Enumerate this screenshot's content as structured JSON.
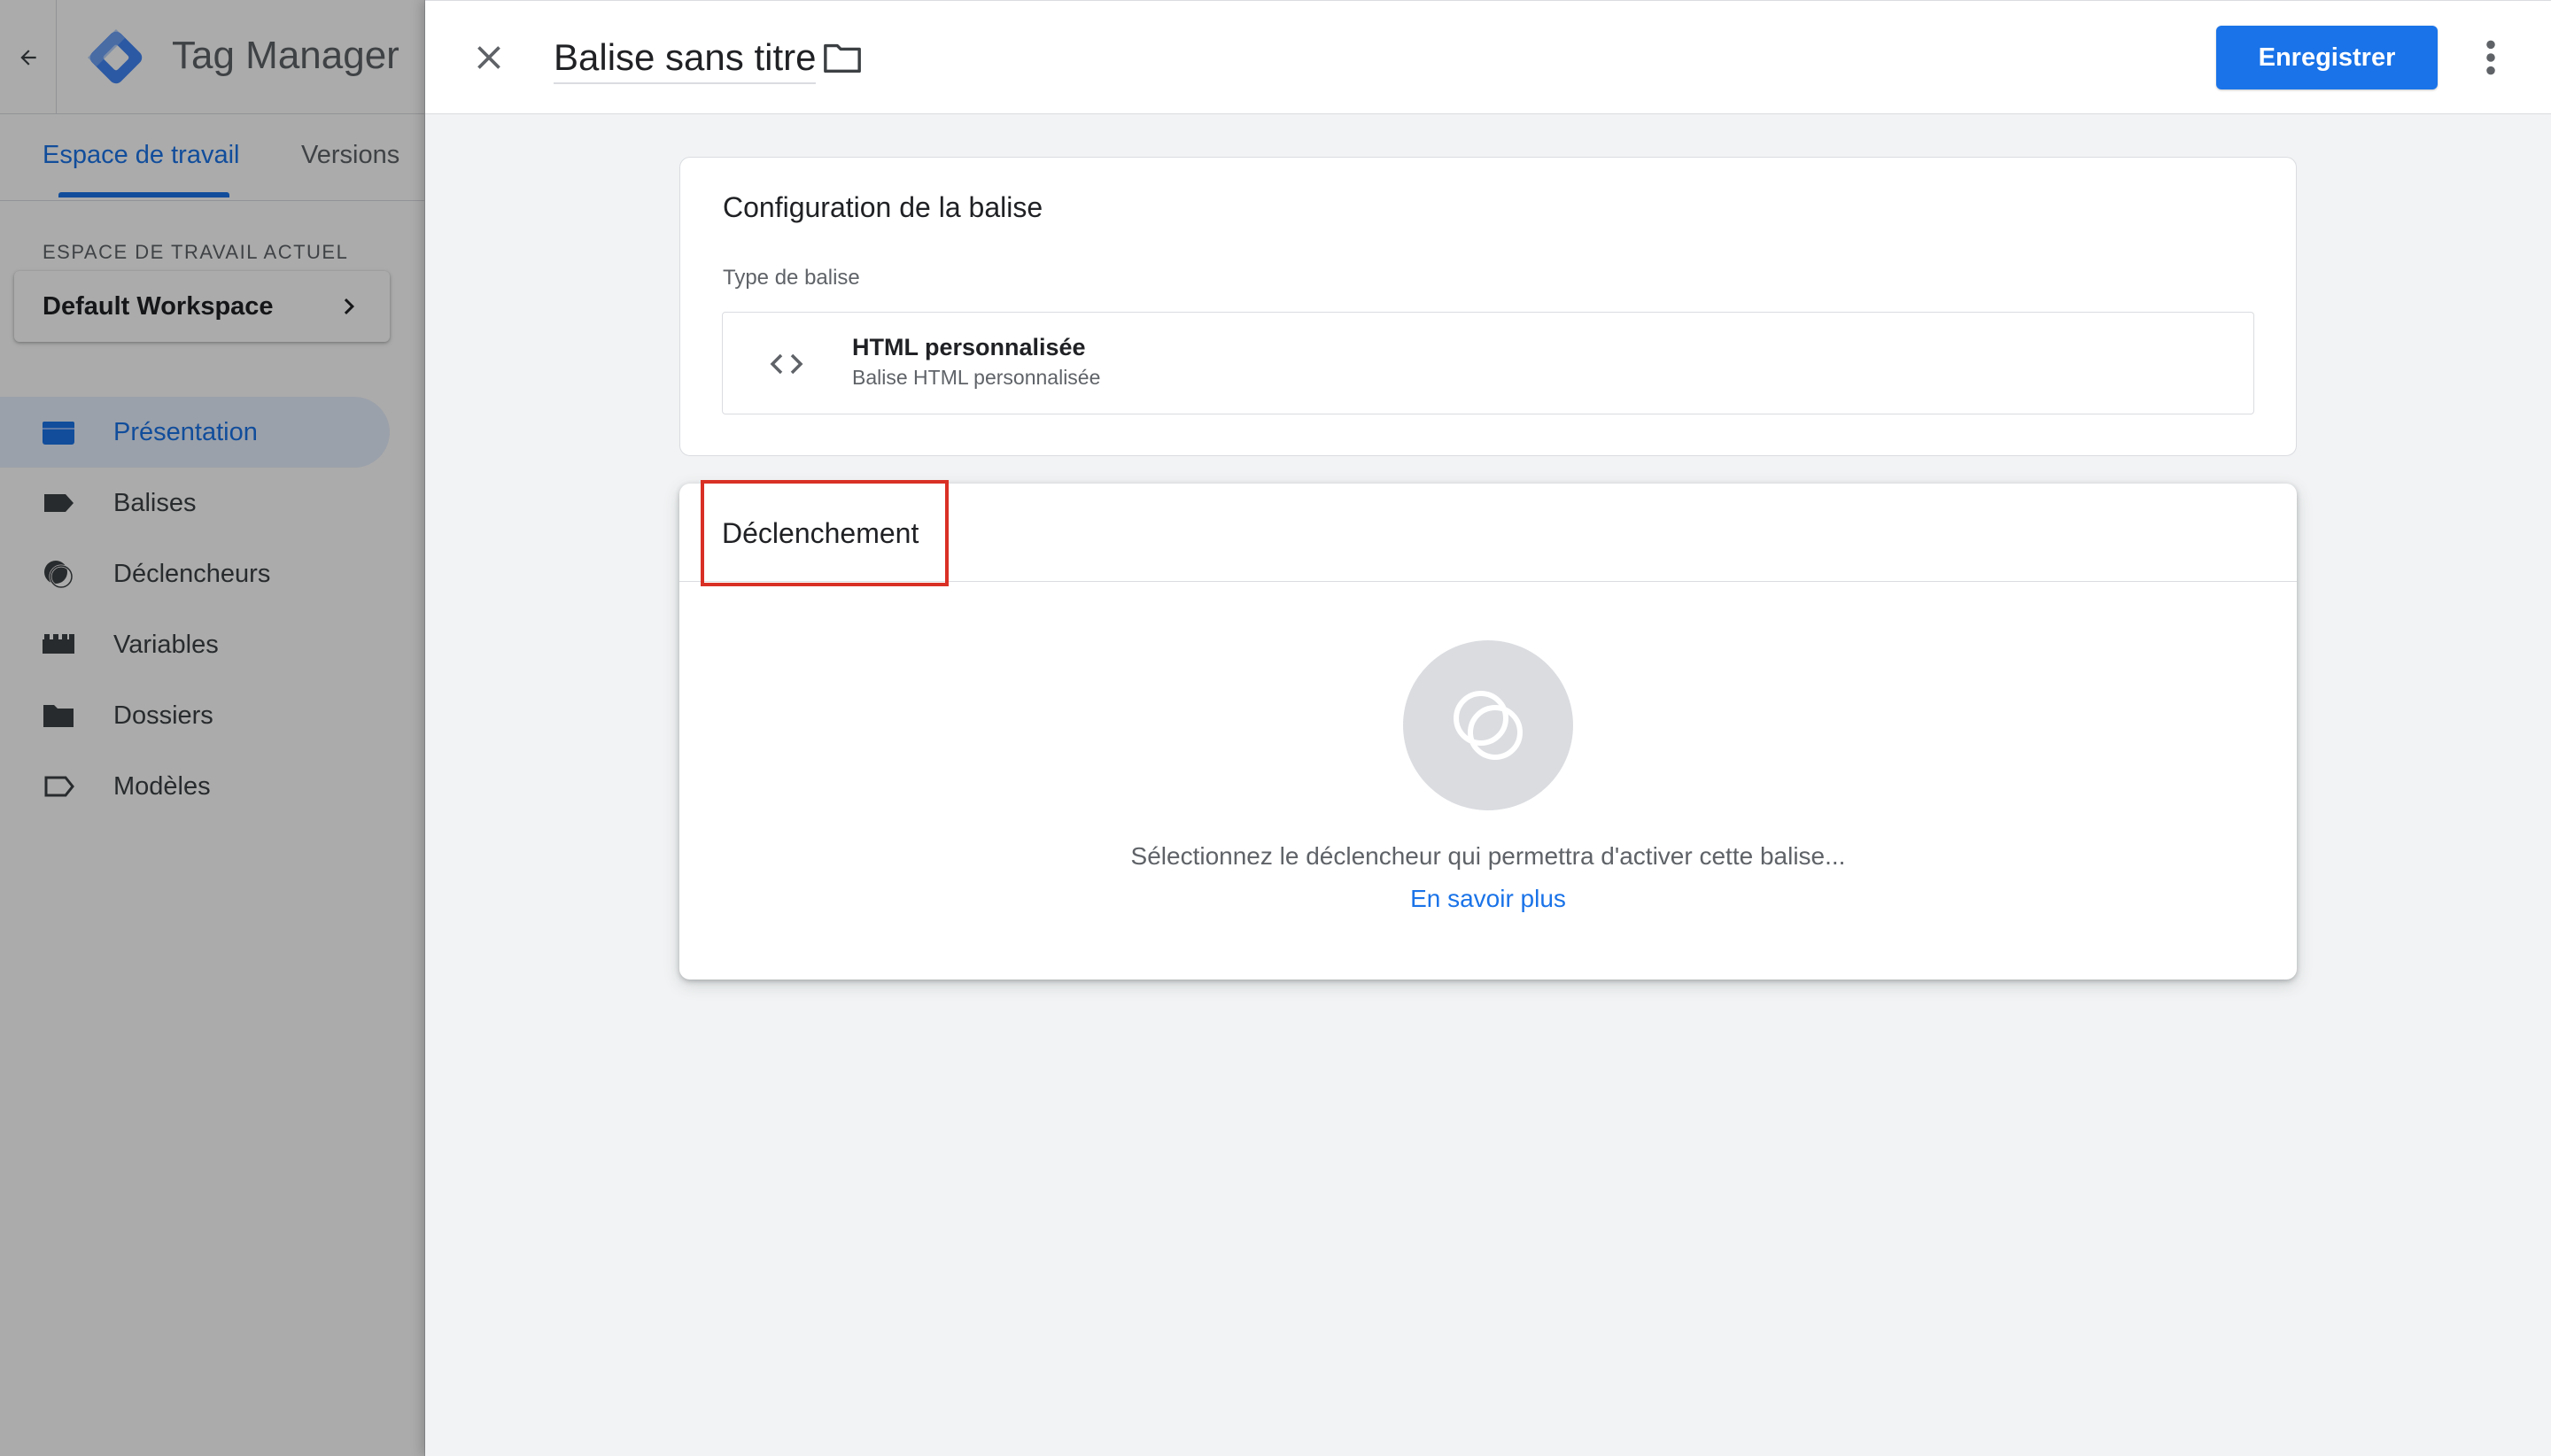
{
  "app": {
    "title": "Tag Manager",
    "brand_color": "#1a73e8"
  },
  "shell": {
    "tabs": [
      {
        "label": "Espace de travail",
        "active": true
      },
      {
        "label": "Versions",
        "active": false
      }
    ],
    "workspace_caption": "ESPACE DE TRAVAIL ACTUEL",
    "workspace_name": "Default Workspace",
    "nav": [
      {
        "label": "Présentation",
        "icon": "overview-icon",
        "active": true
      },
      {
        "label": "Balises",
        "icon": "tag-icon",
        "active": false
      },
      {
        "label": "Déclencheurs",
        "icon": "trigger-icon",
        "active": false
      },
      {
        "label": "Variables",
        "icon": "variables-icon",
        "active": false
      },
      {
        "label": "Dossiers",
        "icon": "folder-icon",
        "active": false
      },
      {
        "label": "Modèles",
        "icon": "template-icon",
        "active": false
      }
    ]
  },
  "editor": {
    "title": "Balise sans titre",
    "save_label": "Enregistrer",
    "config_card": {
      "title": "Configuration de la balise",
      "field_label": "Type de balise",
      "tag_type_name": "HTML personnalisée",
      "tag_type_description": "Balise HTML personnalisée"
    },
    "trigger_card": {
      "title": "Déclenchement",
      "hint": "Sélectionnez le déclencheur qui permettra d'activer cette balise...",
      "learn_more": "En savoir plus",
      "highlight_color": "#d93025"
    }
  }
}
